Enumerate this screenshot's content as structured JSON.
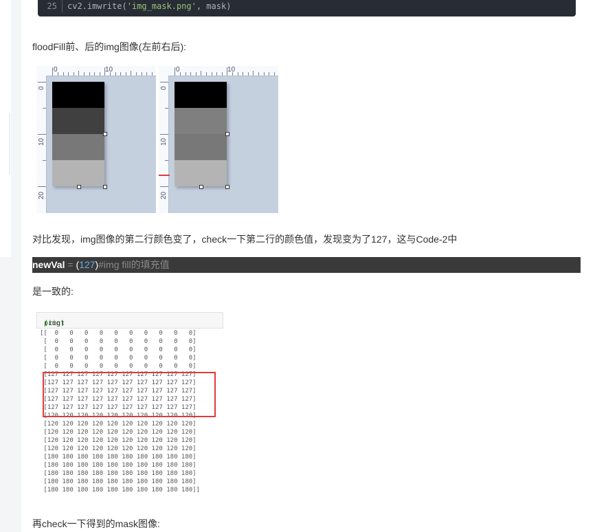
{
  "code_block": {
    "line_number": "25",
    "code_prefix": "cv2.imwrite(",
    "code_string": "'img_mask.png'",
    "code_suffix": ", mask)"
  },
  "paragraphs": {
    "p1": "floodFill前、后的img图像(左前右后):",
    "p2": "对比发现，img图像的第二行颜色变了，check一下第二行的颜色值，发现变为了127，这与Code-2中",
    "p3": "是一致的:",
    "p4": "再check一下得到的mask图像:"
  },
  "inline_code": {
    "keyword": "newVal",
    "operator": " = ",
    "paren_open": "(",
    "number": "127",
    "paren_close": ")",
    "comment": "#img fill的填充值"
  },
  "figure": {
    "ruler_labels": {
      "top_0": "0",
      "top_10": "10",
      "left_0": "0",
      "left_10": "10",
      "left_20": "20"
    },
    "panels": [
      {
        "bands": [
          "#000000",
          "#404040",
          "#787878",
          "#b4b4b4"
        ]
      },
      {
        "bands": [
          "#000000",
          "#7f7f7f",
          "#787878",
          "#b4b4b4"
        ]
      }
    ]
  },
  "notebook": {
    "input_fn": "print",
    "input_args": "(img)",
    "output": "[[  0   0   0   0   0   0   0   0   0   0]\n [  0   0   0   0   0   0   0   0   0   0]\n [  0   0   0   0   0   0   0   0   0   0]\n [  0   0   0   0   0   0   0   0   0   0]\n [  0   0   0   0   0   0   0   0   0   0]\n [127 127 127 127 127 127 127 127 127 127]\n [127 127 127 127 127 127 127 127 127 127]\n [127 127 127 127 127 127 127 127 127 127]\n [127 127 127 127 127 127 127 127 127 127]\n [127 127 127 127 127 127 127 127 127 127]\n [120 120 120 120 120 120 120 120 120 120]\n [120 120 120 120 120 120 120 120 120 120]\n [120 120 120 120 120 120 120 120 120 120]\n [120 120 120 120 120 120 120 120 120 120]\n [120 120 120 120 120 120 120 120 120 120]\n [180 180 180 180 180 180 180 180 180 180]\n [180 180 180 180 180 180 180 180 180 180]\n [180 180 180 180 180 180 180 180 180 180]\n [180 180 180 180 180 180 180 180 180 180]\n [180 180 180 180 180 180 180 180 180 180]]"
  },
  "colors": {
    "code_bg": "#282c34",
    "string": "#98c379",
    "highlight": "#e03a3a",
    "inline_bg": "#3a3a3a"
  }
}
